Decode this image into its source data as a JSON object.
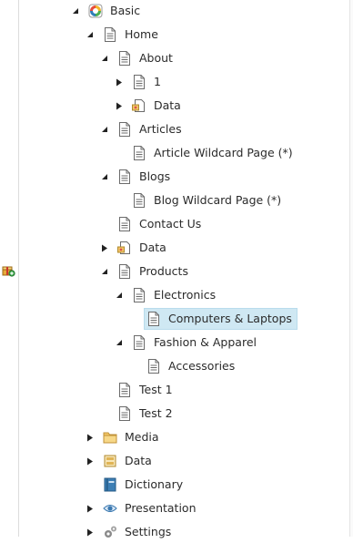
{
  "tree": {
    "items": [
      {
        "label": "Basic",
        "icon": "app-logo-icon",
        "toggle": "expanded"
      },
      {
        "label": "Home",
        "icon": "page-icon",
        "toggle": "expanded"
      },
      {
        "label": "About",
        "icon": "page-icon",
        "toggle": "expanded"
      },
      {
        "label": "1",
        "icon": "page-icon",
        "toggle": "collapsed"
      },
      {
        "label": "Data",
        "icon": "data-folder-icon",
        "toggle": "collapsed"
      },
      {
        "label": "Articles",
        "icon": "page-icon",
        "toggle": "expanded"
      },
      {
        "label": "Article Wildcard Page (*)",
        "icon": "page-icon",
        "toggle": "none"
      },
      {
        "label": "Blogs",
        "icon": "page-icon",
        "toggle": "expanded"
      },
      {
        "label": "Blog Wildcard Page (*)",
        "icon": "page-icon",
        "toggle": "none"
      },
      {
        "label": "Contact Us",
        "icon": "page-icon",
        "toggle": "none"
      },
      {
        "label": "Data",
        "icon": "data-folder-icon",
        "toggle": "collapsed"
      },
      {
        "label": "Products",
        "icon": "page-icon",
        "toggle": "expanded"
      },
      {
        "label": "Electronics",
        "icon": "page-icon",
        "toggle": "expanded"
      },
      {
        "label": "Computers & Laptops",
        "icon": "page-icon",
        "toggle": "none",
        "selected": true
      },
      {
        "label": "Fashion & Apparel",
        "icon": "page-icon",
        "toggle": "expanded"
      },
      {
        "label": "Accessories",
        "icon": "page-icon",
        "toggle": "none"
      },
      {
        "label": "Test 1",
        "icon": "page-icon",
        "toggle": "none"
      },
      {
        "label": "Test 2",
        "icon": "page-icon",
        "toggle": "none"
      },
      {
        "label": "Media",
        "icon": "media-folder-icon",
        "toggle": "collapsed"
      },
      {
        "label": "Data",
        "icon": "data-cube-icon",
        "toggle": "collapsed"
      },
      {
        "label": "Dictionary",
        "icon": "dictionary-icon",
        "toggle": "none"
      },
      {
        "label": "Presentation",
        "icon": "eye-icon",
        "toggle": "collapsed"
      },
      {
        "label": "Settings",
        "icon": "gear-icon",
        "toggle": "collapsed"
      }
    ]
  },
  "colors": {
    "selected_bg": "#cfe8f3",
    "icon_gray": "#6b6b6b",
    "folder_yellow": "#f3c766",
    "brand_blue": "#2f7db8"
  }
}
